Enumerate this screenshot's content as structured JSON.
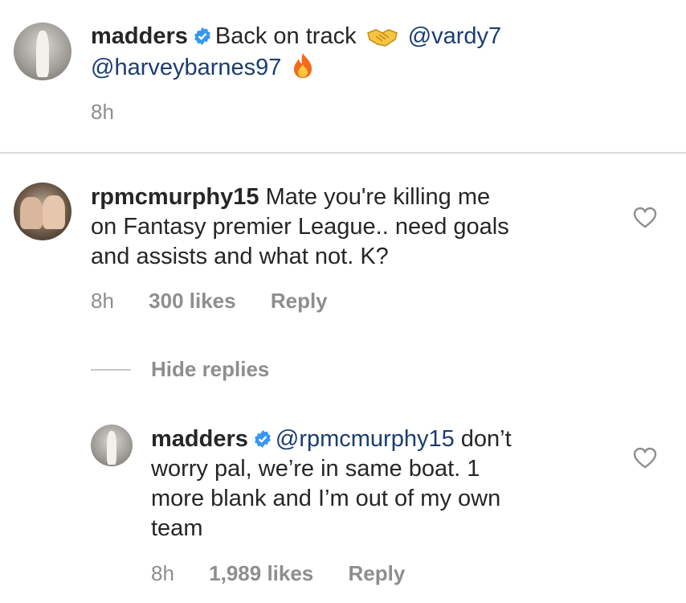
{
  "caption": {
    "username": "madders",
    "text": "Back on track",
    "mention1": "@vardy7",
    "mention2": "@harveybarnes97",
    "emoji1": "handshake-emoji",
    "emoji2": "fire-emoji",
    "time": "8h"
  },
  "comment": {
    "username": "rpmcmurphy15",
    "text_line1": "Mate you're killing me",
    "text_line2": "on Fantasy premier League.. need goals",
    "text_line3": "and assists and what not. K?",
    "time": "8h",
    "likes": "300 likes",
    "reply_label": "Reply"
  },
  "thread": {
    "hide_replies": "Hide replies"
  },
  "reply": {
    "username": "madders",
    "mention": "@rpmcmurphy15",
    "text_line1_rest": "don’t",
    "text_line2": "worry pal, we’re in same boat. 1",
    "text_line3": "more blank and I’m out of my own",
    "text_line4": "team",
    "time": "8h",
    "likes": "1,989 likes",
    "reply_label": "Reply"
  },
  "colors": {
    "mention": "#1c3d70",
    "meta": "#8e8e8e",
    "verified": "#3897f0"
  }
}
